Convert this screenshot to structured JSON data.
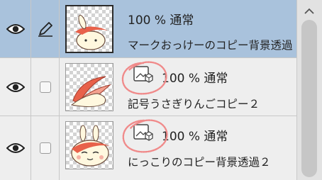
{
  "layers": [
    {
      "opacity": "100 %",
      "blend_mode": "通常",
      "name": "マークおっけーのコピー背景透過",
      "visible": true,
      "selected": true,
      "row_icon": "pen-icon",
      "has_effect_icon": false
    },
    {
      "opacity": "100 %",
      "blend_mode": "通常",
      "name": "記号うさぎりんごコピー２",
      "visible": true,
      "selected": false,
      "row_icon": "checkbox",
      "has_effect_icon": true
    },
    {
      "opacity": "100 %",
      "blend_mode": "通常",
      "name": "にっこりのコピー背景透過２",
      "visible": true,
      "selected": false,
      "row_icon": "checkbox",
      "has_effect_icon": true
    }
  ],
  "colors": {
    "selected_row": "#a9c2dc",
    "annotation_circle": "#f08a8a",
    "thumbnail_accent": "#e8614a"
  }
}
